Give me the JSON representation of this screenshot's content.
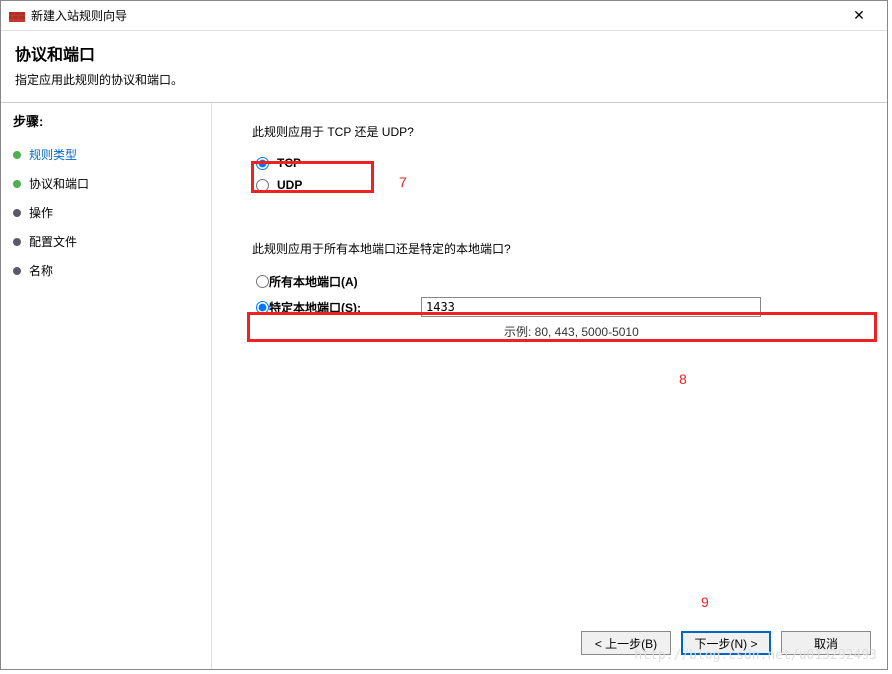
{
  "window": {
    "title": "新建入站规则向导",
    "close": "✕"
  },
  "header": {
    "title": "协议和端口",
    "subtitle": "指定应用此规则的协议和端口。"
  },
  "sidebar": {
    "title": "步骤:",
    "steps": [
      {
        "label": "规则类型",
        "active": true,
        "bullet": "green"
      },
      {
        "label": "协议和端口",
        "active": false,
        "bullet": "green"
      },
      {
        "label": "操作",
        "active": false,
        "bullet": "dark"
      },
      {
        "label": "配置文件",
        "active": false,
        "bullet": "dark"
      },
      {
        "label": "名称",
        "active": false,
        "bullet": "dark"
      }
    ]
  },
  "main": {
    "protocol_question": "此规则应用于 TCP 还是 UDP?",
    "tcp_label": "TCP",
    "udp_label": "UDP",
    "port_question": "此规则应用于所有本地端口还是特定的本地端口?",
    "all_ports_label": "所有本地端口(A)",
    "specific_ports_label": "特定本地端口(S):",
    "port_value": "1433",
    "example_label": "示例: 80, 443, 5000-5010"
  },
  "annotations": {
    "a7": "7",
    "a8": "8",
    "a9": "9"
  },
  "buttons": {
    "back": "< 上一步(B)",
    "next": "下一步(N) >",
    "cancel": "取消"
  },
  "watermark": "http://blog.csdn.net/u013292493"
}
